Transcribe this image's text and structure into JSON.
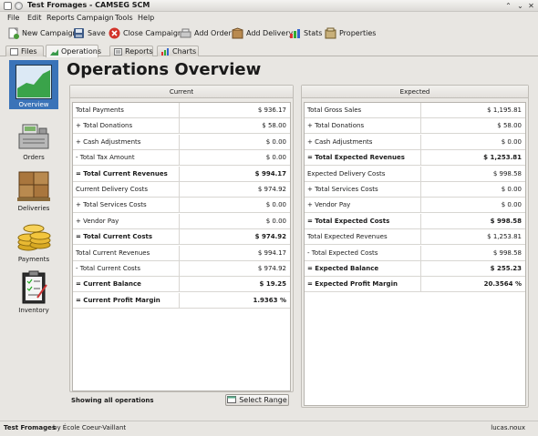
{
  "window": {
    "title": "Test Fromages - CAMSEG SCM",
    "controls": [
      "⌃",
      "⌄",
      "✕"
    ]
  },
  "menu": [
    "File",
    "Edit",
    "Reports",
    "Campaign",
    "Tools",
    "Help"
  ],
  "toolbar": {
    "new_campaign": "New Campaign",
    "save": "Save",
    "close_campaign": "Close Campaign",
    "add_order": "Add Order",
    "add_delivery": "Add Delivery",
    "stats": "Stats",
    "properties": "Properties"
  },
  "tabs": [
    "Files",
    "Operations",
    "Reports",
    "Charts"
  ],
  "sidebar": [
    "Overview",
    "Orders",
    "Deliveries",
    "Payments",
    "Inventory"
  ],
  "page_title": "Operations Overview",
  "current": {
    "header": "Current",
    "rows": [
      {
        "label": "Total Payments",
        "value": "$ 936.17"
      },
      {
        "label": "+ Total Donations",
        "value": "$ 58.00"
      },
      {
        "label": "+ Cash Adjustments",
        "value": "$ 0.00"
      },
      {
        "label": "- Total Tax Amount",
        "value": "$ 0.00"
      },
      {
        "label": "= Total Current Revenues",
        "value": "$ 994.17"
      },
      {
        "label": "Current Delivery Costs",
        "value": "$ 974.92"
      },
      {
        "label": "+ Total Services Costs",
        "value": "$ 0.00"
      },
      {
        "label": "+ Vendor Pay",
        "value": "$ 0.00"
      },
      {
        "label": "= Total Current Costs",
        "value": "$ 974.92"
      },
      {
        "label": "Total Current Revenues",
        "value": "$ 994.17"
      },
      {
        "label": "- Total Current Costs",
        "value": "$ 974.92"
      },
      {
        "label": "= Current Balance",
        "value": "$ 19.25"
      },
      {
        "label": "= Current Profit Margin",
        "value": "1.9363 %"
      }
    ]
  },
  "expected": {
    "header": "Expected",
    "rows": [
      {
        "label": "Total Gross Sales",
        "value": "$ 1,195.81"
      },
      {
        "label": "+ Total Donations",
        "value": "$ 58.00"
      },
      {
        "label": "+ Cash Adjustments",
        "value": "$ 0.00"
      },
      {
        "label": "= Total Expected Revenues",
        "value": "$ 1,253.81"
      },
      {
        "label": "Expected Delivery Costs",
        "value": "$ 998.58"
      },
      {
        "label": "+ Total Services Costs",
        "value": "$ 0.00"
      },
      {
        "label": "+ Vendor Pay",
        "value": "$ 0.00"
      },
      {
        "label": "= Total Expected Costs",
        "value": "$ 998.58"
      },
      {
        "label": "Total Expected Revenues",
        "value": "$ 1,253.81"
      },
      {
        "label": "- Total Expected Costs",
        "value": "$ 998.58"
      },
      {
        "label": "= Expected Balance",
        "value": "$ 255.23"
      },
      {
        "label": "= Expected Profit Margin",
        "value": "20.3564 %"
      }
    ]
  },
  "footer": {
    "showing": "Showing all operations",
    "select_range": "Select Range"
  },
  "status": {
    "left": "Test Fromages",
    "left_suffix": " by École Coeur-Vaillant",
    "right": "lucas.noux"
  }
}
